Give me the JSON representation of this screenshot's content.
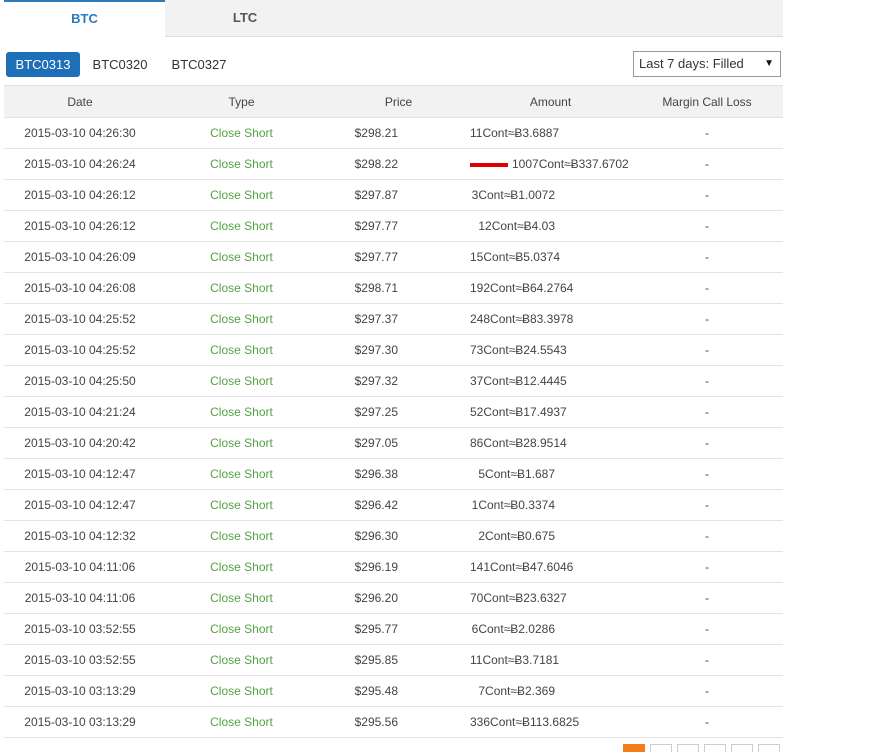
{
  "tabs": [
    {
      "label": "BTC",
      "active": true
    },
    {
      "label": "LTC",
      "active": false
    }
  ],
  "contracts": [
    {
      "label": "BTC0313",
      "active": true
    },
    {
      "label": "BTC0320",
      "active": false
    },
    {
      "label": "BTC0327",
      "active": false
    }
  ],
  "filter": {
    "selected": "Last 7 days: Filled"
  },
  "table": {
    "headers": [
      "Date",
      "Type",
      "Price",
      "Amount",
      "Margin Call Loss"
    ],
    "rows": [
      {
        "date": "2015-03-10 04:26:30",
        "type": "Close Short",
        "price": "$298.21",
        "amount": "11Cont≈Ƀ3.6887",
        "loss": "-"
      },
      {
        "date": "2015-03-10 04:26:24",
        "type": "Close Short",
        "price": "$298.22",
        "amount": "1007Cont≈Ƀ337.6702",
        "loss": "-",
        "marked": true
      },
      {
        "date": "2015-03-10 04:26:12",
        "type": "Close Short",
        "price": "$297.87",
        "amount": "3Cont≈Ƀ1.0072",
        "loss": "-"
      },
      {
        "date": "2015-03-10 04:26:12",
        "type": "Close Short",
        "price": "$297.77",
        "amount": "12Cont≈Ƀ4.03",
        "loss": "-"
      },
      {
        "date": "2015-03-10 04:26:09",
        "type": "Close Short",
        "price": "$297.77",
        "amount": "15Cont≈Ƀ5.0374",
        "loss": "-"
      },
      {
        "date": "2015-03-10 04:26:08",
        "type": "Close Short",
        "price": "$298.71",
        "amount": "192Cont≈Ƀ64.2764",
        "loss": "-"
      },
      {
        "date": "2015-03-10 04:25:52",
        "type": "Close Short",
        "price": "$297.37",
        "amount": "248Cont≈Ƀ83.3978",
        "loss": "-"
      },
      {
        "date": "2015-03-10 04:25:52",
        "type": "Close Short",
        "price": "$297.30",
        "amount": "73Cont≈Ƀ24.5543",
        "loss": "-"
      },
      {
        "date": "2015-03-10 04:25:50",
        "type": "Close Short",
        "price": "$297.32",
        "amount": "37Cont≈Ƀ12.4445",
        "loss": "-"
      },
      {
        "date": "2015-03-10 04:21:24",
        "type": "Close Short",
        "price": "$297.25",
        "amount": "52Cont≈Ƀ17.4937",
        "loss": "-"
      },
      {
        "date": "2015-03-10 04:20:42",
        "type": "Close Short",
        "price": "$297.05",
        "amount": "86Cont≈Ƀ28.9514",
        "loss": "-"
      },
      {
        "date": "2015-03-10 04:12:47",
        "type": "Close Short",
        "price": "$296.38",
        "amount": "5Cont≈Ƀ1.687",
        "loss": "-"
      },
      {
        "date": "2015-03-10 04:12:47",
        "type": "Close Short",
        "price": "$296.42",
        "amount": "1Cont≈Ƀ0.3374",
        "loss": "-"
      },
      {
        "date": "2015-03-10 04:12:32",
        "type": "Close Short",
        "price": "$296.30",
        "amount": "2Cont≈Ƀ0.675",
        "loss": "-"
      },
      {
        "date": "2015-03-10 04:11:06",
        "type": "Close Short",
        "price": "$296.19",
        "amount": "141Cont≈Ƀ47.6046",
        "loss": "-"
      },
      {
        "date": "2015-03-10 04:11:06",
        "type": "Close Short",
        "price": "$296.20",
        "amount": "70Cont≈Ƀ23.6327",
        "loss": "-"
      },
      {
        "date": "2015-03-10 03:52:55",
        "type": "Close Short",
        "price": "$295.77",
        "amount": "6Cont≈Ƀ2.0286",
        "loss": "-"
      },
      {
        "date": "2015-03-10 03:52:55",
        "type": "Close Short",
        "price": "$295.85",
        "amount": "11Cont≈Ƀ3.7181",
        "loss": "-"
      },
      {
        "date": "2015-03-10 03:13:29",
        "type": "Close Short",
        "price": "$295.48",
        "amount": "7Cont≈Ƀ2.369",
        "loss": "-"
      },
      {
        "date": "2015-03-10 03:13:29",
        "type": "Close Short",
        "price": "$295.56",
        "amount": "336Cont≈Ƀ113.6825",
        "loss": "-"
      }
    ]
  },
  "pagination": {
    "page_count": 6,
    "current_index": 0
  },
  "colors": {
    "accent": "#2a7bbf",
    "pill_active": "#1d6fb8",
    "type_text": "#55a146",
    "marker": "#e00000",
    "pager_current": "#f17e1b"
  }
}
